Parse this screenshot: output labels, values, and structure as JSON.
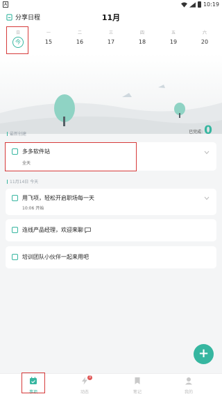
{
  "status_bar": {
    "time": "10:19",
    "left_icon": "A"
  },
  "header": {
    "share_label": "分享日程",
    "month": "11月"
  },
  "week": [
    {
      "weekday": "日",
      "date": "今",
      "today": true
    },
    {
      "weekday": "一",
      "date": "15"
    },
    {
      "weekday": "二",
      "date": "16"
    },
    {
      "weekday": "三",
      "date": "17"
    },
    {
      "weekday": "四",
      "date": "18"
    },
    {
      "weekday": "五",
      "date": "19"
    },
    {
      "weekday": "六",
      "date": "20"
    }
  ],
  "recent": {
    "label": "最新创建",
    "done_label": "已完成:",
    "done_count": "0"
  },
  "recent_item": {
    "title": "多多软件站",
    "subtitle": "全天"
  },
  "dated": {
    "label": "11月14日 今天"
  },
  "items": [
    {
      "title": "用飞项，轻松开启职场每一天",
      "subtitle": "10:06 开始"
    },
    {
      "title": "连线产品经理，欢迎来聊"
    },
    {
      "title": "培训团队小伙伴一起来用吧"
    }
  ],
  "tabs": [
    {
      "label": "事项",
      "icon": "calendar-icon",
      "active": true
    },
    {
      "label": "动态",
      "icon": "bolt-icon",
      "badge": "3"
    },
    {
      "label": "笔记",
      "icon": "bookmark-icon"
    },
    {
      "label": "我的",
      "icon": "profile-icon"
    }
  ],
  "colors": {
    "accent": "#36b6a0",
    "highlight": "#d63a3a"
  }
}
